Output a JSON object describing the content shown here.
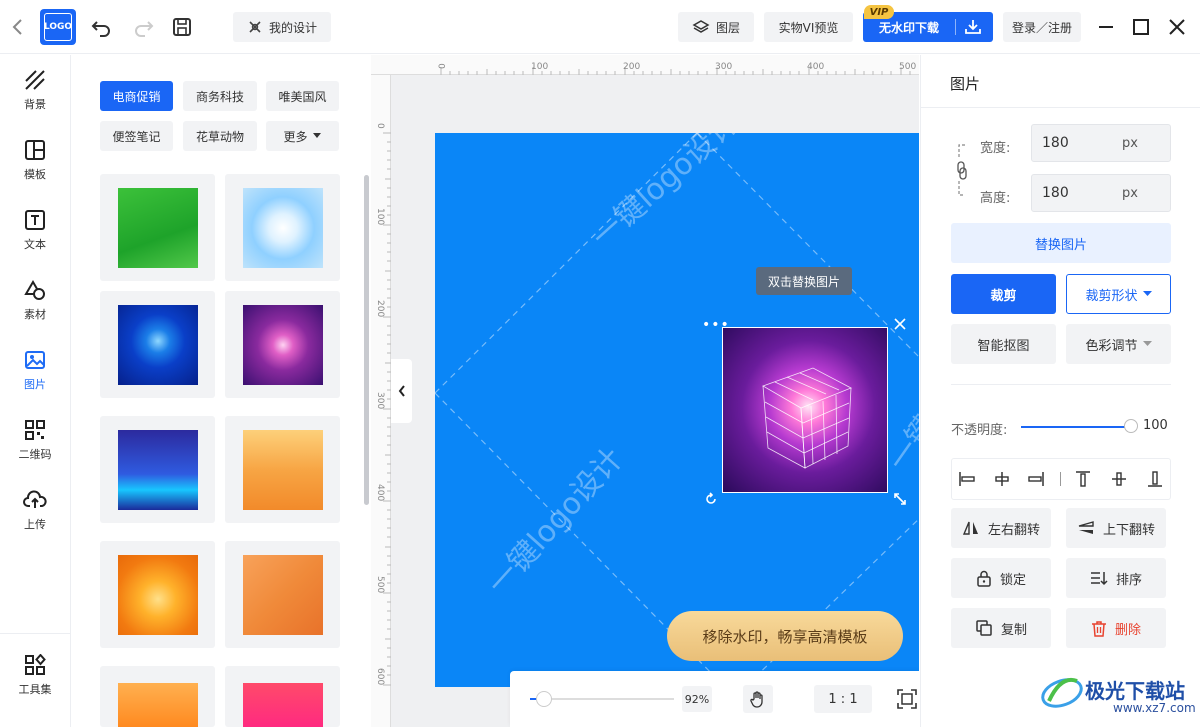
{
  "header": {
    "my_design": "我的设计",
    "layers": "图层",
    "vi_preview": "实物VI预览",
    "vip_badge": "VIP",
    "download": "无水印下载",
    "login": "登录／注册",
    "logo_text": "LOGO"
  },
  "leftnav": {
    "items": [
      {
        "label": "背景",
        "icon": "background-icon"
      },
      {
        "label": "模板",
        "icon": "template-icon"
      },
      {
        "label": "文本",
        "icon": "text-icon"
      },
      {
        "label": "素材",
        "icon": "material-icon"
      },
      {
        "label": "图片",
        "icon": "image-icon"
      },
      {
        "label": "二维码",
        "icon": "qrcode-icon"
      },
      {
        "label": "上传",
        "icon": "upload-icon"
      }
    ],
    "toolbox": "工具集",
    "active_index": 4
  },
  "categories": [
    {
      "label": "电商促销",
      "active": true
    },
    {
      "label": "商务科技",
      "active": false
    },
    {
      "label": "唯美国风",
      "active": false
    },
    {
      "label": "便签笔记",
      "active": false
    },
    {
      "label": "花草动物",
      "active": false
    },
    {
      "label": "更多",
      "active": false
    }
  ],
  "ruler": {
    "top": [
      "0",
      "100",
      "200",
      "300",
      "400",
      "500"
    ],
    "left": [
      "0",
      "100",
      "200",
      "300",
      "400",
      "500",
      "600"
    ]
  },
  "canvas": {
    "background": "#0a86f7",
    "watermark": "一键logo设计",
    "tooltip": "双击替换图片",
    "promo": "移除水印，畅享高清模板"
  },
  "zoom": {
    "level": "0.92",
    "percent": "92%",
    "ratio": "1 : 1"
  },
  "props": {
    "title": "图片",
    "width_label": "宽度:",
    "width_value": "180",
    "height_label": "高度:",
    "height_value": "180",
    "unit": "px",
    "replace": "替换图片",
    "crop": "裁剪",
    "crop_shape": "裁剪形状",
    "smart_cutout": "智能抠图",
    "color_adjust": "色彩调节",
    "opacity_label": "不透明度:",
    "opacity_value": "100",
    "flip_h": "左右翻转",
    "flip_v": "上下翻转",
    "lock": "锁定",
    "order": "排序",
    "copy": "复制",
    "delete": "删除"
  },
  "branding": {
    "site_name": "极光下载站",
    "site_url": "www.xz7.com"
  },
  "colors": {
    "primary": "#1a66f5",
    "canvas": "#0a86f7",
    "delete": "#e8432f",
    "vip": "#f5c441"
  }
}
